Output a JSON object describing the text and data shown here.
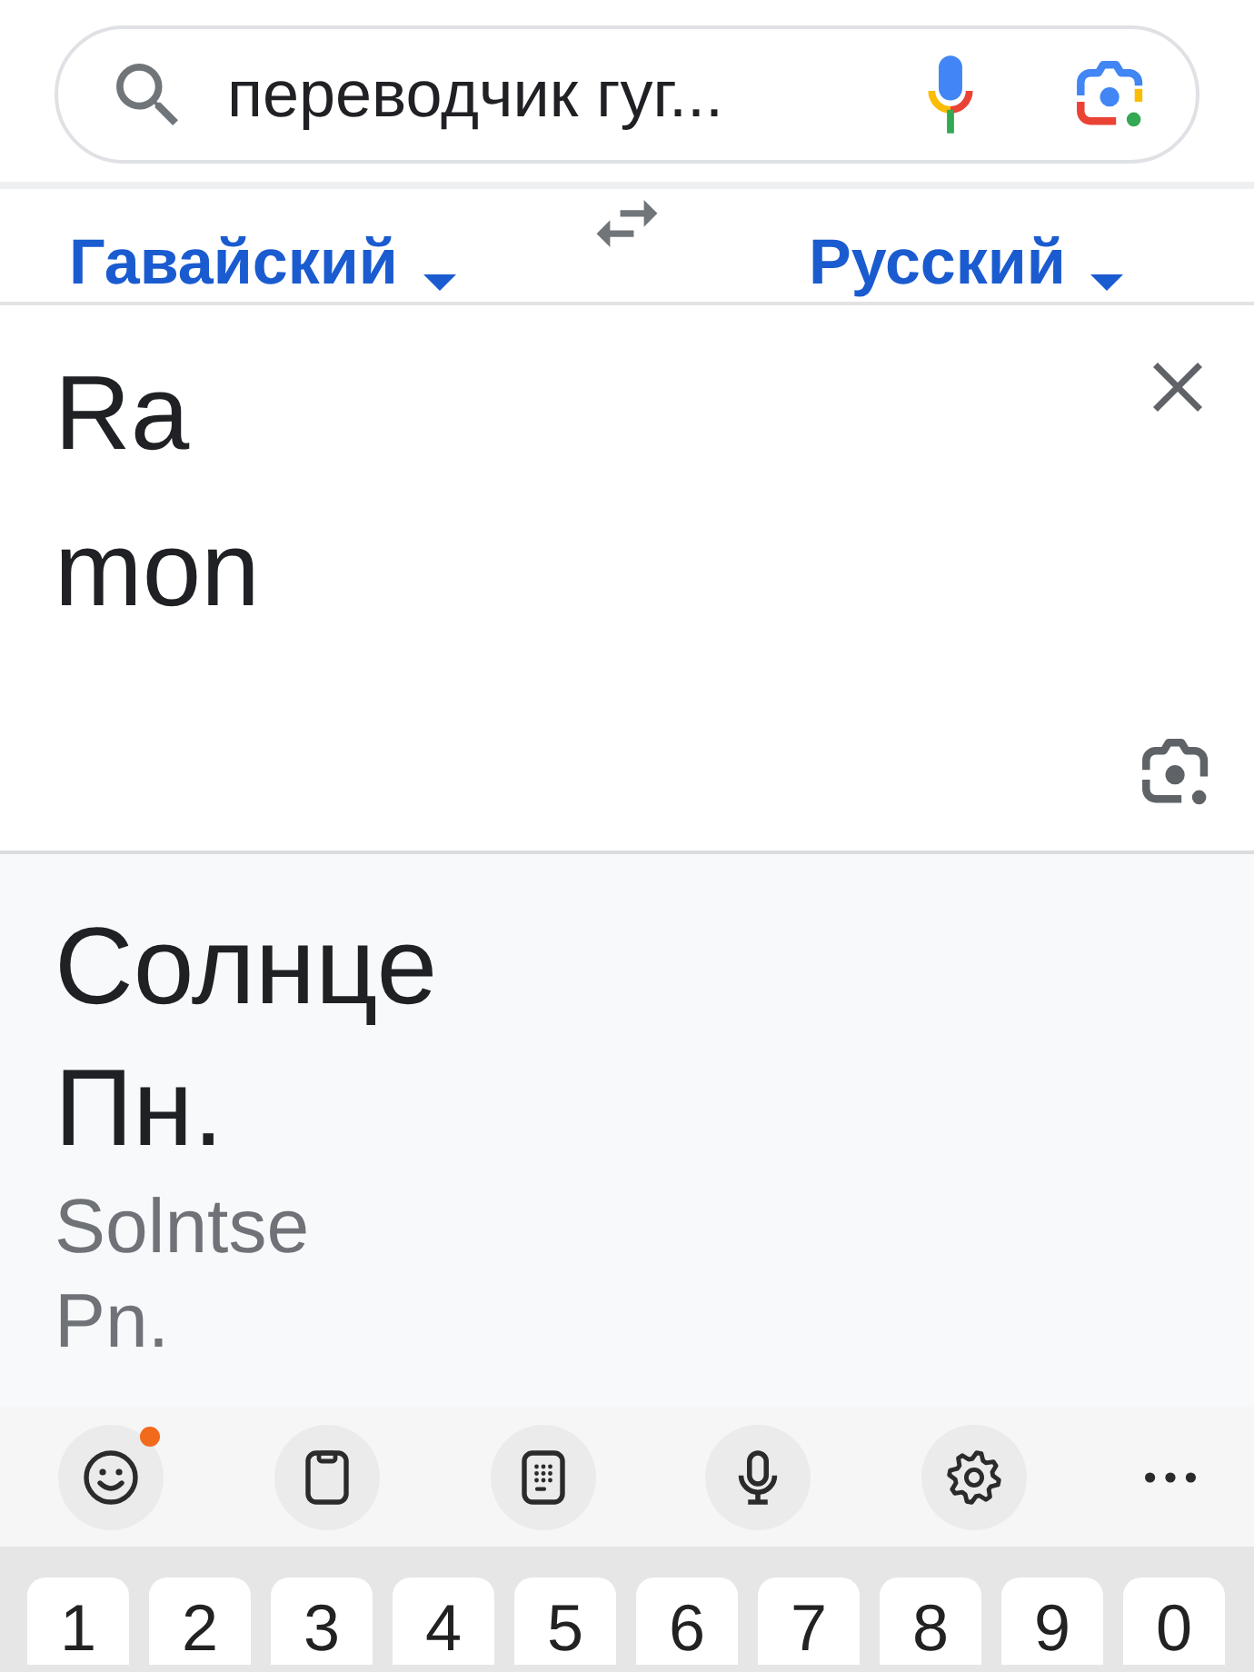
{
  "search": {
    "value": "переводчик гуг..."
  },
  "languages": {
    "source": "Гавайский",
    "target": "Русский"
  },
  "input": {
    "text": "Ra\nmon"
  },
  "output": {
    "translation": "Солнце\nПн.",
    "transliteration": "Solntse\nPn."
  },
  "keyboard": {
    "toolbar": [
      {
        "kind": "emoji",
        "badge": true
      },
      {
        "kind": "clipboard",
        "badge": false
      },
      {
        "kind": "keypad",
        "badge": false
      },
      {
        "kind": "voice",
        "badge": false
      },
      {
        "kind": "settings",
        "badge": false
      },
      {
        "kind": "more",
        "badge": false
      }
    ],
    "keys": [
      "1",
      "2",
      "3",
      "4",
      "5",
      "6",
      "7",
      "8",
      "9",
      "0"
    ]
  }
}
